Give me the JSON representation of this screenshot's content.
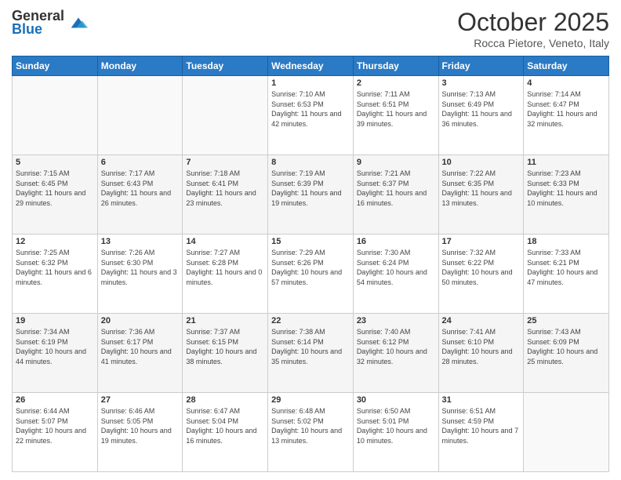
{
  "logo": {
    "line1": "General",
    "line2": "Blue"
  },
  "header": {
    "month": "October 2025",
    "location": "Rocca Pietore, Veneto, Italy"
  },
  "weekdays": [
    "Sunday",
    "Monday",
    "Tuesday",
    "Wednesday",
    "Thursday",
    "Friday",
    "Saturday"
  ],
  "weeks": [
    [
      {
        "day": "",
        "sunrise": "",
        "sunset": "",
        "daylight": ""
      },
      {
        "day": "",
        "sunrise": "",
        "sunset": "",
        "daylight": ""
      },
      {
        "day": "",
        "sunrise": "",
        "sunset": "",
        "daylight": ""
      },
      {
        "day": "1",
        "sunrise": "Sunrise: 7:10 AM",
        "sunset": "Sunset: 6:53 PM",
        "daylight": "Daylight: 11 hours and 42 minutes."
      },
      {
        "day": "2",
        "sunrise": "Sunrise: 7:11 AM",
        "sunset": "Sunset: 6:51 PM",
        "daylight": "Daylight: 11 hours and 39 minutes."
      },
      {
        "day": "3",
        "sunrise": "Sunrise: 7:13 AM",
        "sunset": "Sunset: 6:49 PM",
        "daylight": "Daylight: 11 hours and 36 minutes."
      },
      {
        "day": "4",
        "sunrise": "Sunrise: 7:14 AM",
        "sunset": "Sunset: 6:47 PM",
        "daylight": "Daylight: 11 hours and 32 minutes."
      }
    ],
    [
      {
        "day": "5",
        "sunrise": "Sunrise: 7:15 AM",
        "sunset": "Sunset: 6:45 PM",
        "daylight": "Daylight: 11 hours and 29 minutes."
      },
      {
        "day": "6",
        "sunrise": "Sunrise: 7:17 AM",
        "sunset": "Sunset: 6:43 PM",
        "daylight": "Daylight: 11 hours and 26 minutes."
      },
      {
        "day": "7",
        "sunrise": "Sunrise: 7:18 AM",
        "sunset": "Sunset: 6:41 PM",
        "daylight": "Daylight: 11 hours and 23 minutes."
      },
      {
        "day": "8",
        "sunrise": "Sunrise: 7:19 AM",
        "sunset": "Sunset: 6:39 PM",
        "daylight": "Daylight: 11 hours and 19 minutes."
      },
      {
        "day": "9",
        "sunrise": "Sunrise: 7:21 AM",
        "sunset": "Sunset: 6:37 PM",
        "daylight": "Daylight: 11 hours and 16 minutes."
      },
      {
        "day": "10",
        "sunrise": "Sunrise: 7:22 AM",
        "sunset": "Sunset: 6:35 PM",
        "daylight": "Daylight: 11 hours and 13 minutes."
      },
      {
        "day": "11",
        "sunrise": "Sunrise: 7:23 AM",
        "sunset": "Sunset: 6:33 PM",
        "daylight": "Daylight: 11 hours and 10 minutes."
      }
    ],
    [
      {
        "day": "12",
        "sunrise": "Sunrise: 7:25 AM",
        "sunset": "Sunset: 6:32 PM",
        "daylight": "Daylight: 11 hours and 6 minutes."
      },
      {
        "day": "13",
        "sunrise": "Sunrise: 7:26 AM",
        "sunset": "Sunset: 6:30 PM",
        "daylight": "Daylight: 11 hours and 3 minutes."
      },
      {
        "day": "14",
        "sunrise": "Sunrise: 7:27 AM",
        "sunset": "Sunset: 6:28 PM",
        "daylight": "Daylight: 11 hours and 0 minutes."
      },
      {
        "day": "15",
        "sunrise": "Sunrise: 7:29 AM",
        "sunset": "Sunset: 6:26 PM",
        "daylight": "Daylight: 10 hours and 57 minutes."
      },
      {
        "day": "16",
        "sunrise": "Sunrise: 7:30 AM",
        "sunset": "Sunset: 6:24 PM",
        "daylight": "Daylight: 10 hours and 54 minutes."
      },
      {
        "day": "17",
        "sunrise": "Sunrise: 7:32 AM",
        "sunset": "Sunset: 6:22 PM",
        "daylight": "Daylight: 10 hours and 50 minutes."
      },
      {
        "day": "18",
        "sunrise": "Sunrise: 7:33 AM",
        "sunset": "Sunset: 6:21 PM",
        "daylight": "Daylight: 10 hours and 47 minutes."
      }
    ],
    [
      {
        "day": "19",
        "sunrise": "Sunrise: 7:34 AM",
        "sunset": "Sunset: 6:19 PM",
        "daylight": "Daylight: 10 hours and 44 minutes."
      },
      {
        "day": "20",
        "sunrise": "Sunrise: 7:36 AM",
        "sunset": "Sunset: 6:17 PM",
        "daylight": "Daylight: 10 hours and 41 minutes."
      },
      {
        "day": "21",
        "sunrise": "Sunrise: 7:37 AM",
        "sunset": "Sunset: 6:15 PM",
        "daylight": "Daylight: 10 hours and 38 minutes."
      },
      {
        "day": "22",
        "sunrise": "Sunrise: 7:38 AM",
        "sunset": "Sunset: 6:14 PM",
        "daylight": "Daylight: 10 hours and 35 minutes."
      },
      {
        "day": "23",
        "sunrise": "Sunrise: 7:40 AM",
        "sunset": "Sunset: 6:12 PM",
        "daylight": "Daylight: 10 hours and 32 minutes."
      },
      {
        "day": "24",
        "sunrise": "Sunrise: 7:41 AM",
        "sunset": "Sunset: 6:10 PM",
        "daylight": "Daylight: 10 hours and 28 minutes."
      },
      {
        "day": "25",
        "sunrise": "Sunrise: 7:43 AM",
        "sunset": "Sunset: 6:09 PM",
        "daylight": "Daylight: 10 hours and 25 minutes."
      }
    ],
    [
      {
        "day": "26",
        "sunrise": "Sunrise: 6:44 AM",
        "sunset": "Sunset: 5:07 PM",
        "daylight": "Daylight: 10 hours and 22 minutes."
      },
      {
        "day": "27",
        "sunrise": "Sunrise: 6:46 AM",
        "sunset": "Sunset: 5:05 PM",
        "daylight": "Daylight: 10 hours and 19 minutes."
      },
      {
        "day": "28",
        "sunrise": "Sunrise: 6:47 AM",
        "sunset": "Sunset: 5:04 PM",
        "daylight": "Daylight: 10 hours and 16 minutes."
      },
      {
        "day": "29",
        "sunrise": "Sunrise: 6:48 AM",
        "sunset": "Sunset: 5:02 PM",
        "daylight": "Daylight: 10 hours and 13 minutes."
      },
      {
        "day": "30",
        "sunrise": "Sunrise: 6:50 AM",
        "sunset": "Sunset: 5:01 PM",
        "daylight": "Daylight: 10 hours and 10 minutes."
      },
      {
        "day": "31",
        "sunrise": "Sunrise: 6:51 AM",
        "sunset": "Sunset: 4:59 PM",
        "daylight": "Daylight: 10 hours and 7 minutes."
      },
      {
        "day": "",
        "sunrise": "",
        "sunset": "",
        "daylight": ""
      }
    ]
  ]
}
